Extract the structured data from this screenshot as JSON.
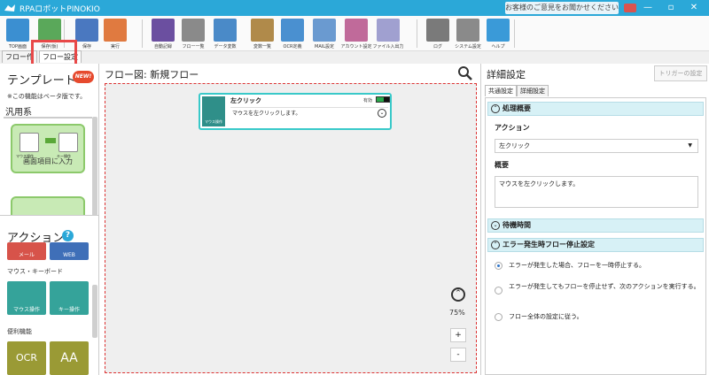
{
  "app": {
    "title": "RPAロボットPINOKIO",
    "feedback": "お客様のご意見をお聞かせください"
  },
  "ribbon": {
    "items": [
      {
        "label": "TOP画面",
        "icon": "home-icon",
        "color": "#3b8fd1"
      },
      {
        "label": "保存(仮)",
        "icon": "save-icon",
        "color": "#5aa85a"
      },
      {
        "label": "保存",
        "icon": "disk-icon",
        "color": "#4a78c0"
      },
      {
        "label": "実行",
        "icon": "play-icon",
        "color": "#e07a40"
      },
      {
        "label": "自動記録",
        "icon": "record-icon",
        "color": "#6b4fa0"
      },
      {
        "label": "フロー一覧",
        "icon": "list-icon",
        "color": "#8a8a8a"
      },
      {
        "label": "データ変数",
        "icon": "data-icon",
        "color": "#4a8ac8"
      },
      {
        "label": "変数一覧",
        "icon": "variable-icon",
        "color": "#b08a4a"
      },
      {
        "label": "OCR定義",
        "icon": "ocr-icon",
        "color": "#4a90d0"
      },
      {
        "label": "MAIL設定",
        "icon": "mail-icon",
        "color": "#6a9ad0"
      },
      {
        "label": "アカウント設定",
        "icon": "account-icon",
        "color": "#c06a9a"
      },
      {
        "label": "ファイル入出力",
        "icon": "file-io-icon",
        "color": "#a0a0d0"
      },
      {
        "label": "ログ",
        "icon": "log-icon",
        "color": "#7a7a7a"
      },
      {
        "label": "システム設定",
        "icon": "gear-icon",
        "color": "#8a8a8a"
      },
      {
        "label": "ヘルプ",
        "icon": "help-icon",
        "color": "#3a9ad8"
      }
    ]
  },
  "left": {
    "tabs": [
      "フロー作",
      "フロー設定"
    ],
    "template_title": "テンプレート",
    "new_badge": "NEW!",
    "beta_note": "※この機能はベータ版です。",
    "category": "汎用系",
    "template_card": "画面項目に入力",
    "template_card_left": "マウス操作",
    "template_card_right": "キー操作",
    "action_title": "アクション",
    "action_tiles_top": [
      "メール",
      "WEB"
    ],
    "action_cat1": "マウス・キーボード",
    "action_tiles1": [
      "マウス操作",
      "キー操作"
    ],
    "action_cat2": "便利機能",
    "action_tiles2": [
      "OCR",
      "AA"
    ]
  },
  "flow": {
    "title": "フロー図:  新規フロー",
    "node": {
      "name": "左クリック",
      "enabled_label": "有効",
      "category": "マウス操作",
      "description": "マウスを左クリックします。"
    },
    "zoom": "75%",
    "zoom_in": "+",
    "zoom_out": "-"
  },
  "detail": {
    "title": "詳細設定",
    "trigger_button": "トリガーの設定",
    "tabs": [
      "共通設定",
      "詳細設定"
    ],
    "section1": "処理概要",
    "action_label": "アクション",
    "action_value": "左クリック",
    "summary_label": "概要",
    "summary_value": "マウスを左クリックします。",
    "section2": "待機時間",
    "section3": "エラー発生時フロー停止設定",
    "radios": [
      {
        "text": "エラーが発生した場合、フローを一時停止する。",
        "selected": true
      },
      {
        "text": "エラーが発生してもフローを停止せず、次のアクションを実行する。",
        "selected": false
      },
      {
        "text": "フロー全体の設定に従う。",
        "selected": false
      }
    ]
  }
}
